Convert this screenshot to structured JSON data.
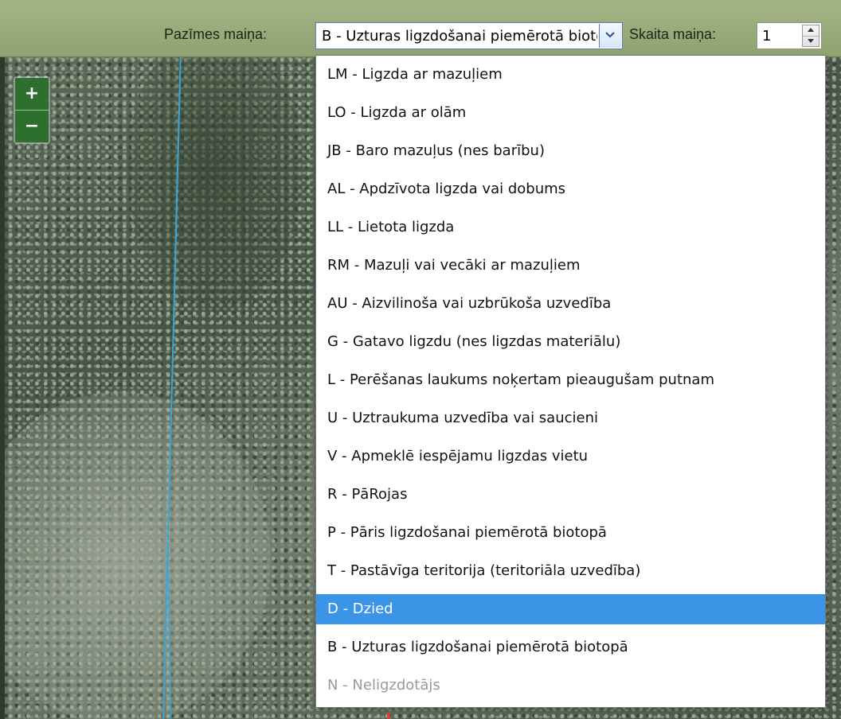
{
  "toolbar": {
    "attribute_label": "Pazīmes maiņa:",
    "attribute_value": "B - Uzturas ligzdošanai piemērotā biotopā",
    "count_label": "Skaita maiņa:",
    "count_value": "1"
  },
  "map": {
    "zoom_in_label": "+",
    "zoom_out_label": "−"
  },
  "dropdown": {
    "options": [
      {
        "label": "LM - Ligzda ar mazuļiem"
      },
      {
        "label": "LO - Ligzda ar olām"
      },
      {
        "label": "JB - Baro mazuļus (nes barību)"
      },
      {
        "label": "AL - Apdzīvota ligzda vai dobums"
      },
      {
        "label": "LL - Lietota ligzda"
      },
      {
        "label": "RM - Mazuļi vai vecāki ar mazuļiem"
      },
      {
        "label": "AU - Aizvilinoša vai uzbrūkoša uzvedība"
      },
      {
        "label": "G - Gatavo ligzdu (nes ligzdas materiālu)"
      },
      {
        "label": "L - Perēšanas laukums noķertam pieaugušam putnam"
      },
      {
        "label": "U - Uztraukuma uzvedība vai saucieni"
      },
      {
        "label": "V - Apmeklē iespējamu ligzdas vietu"
      },
      {
        "label": "R - PāRojas"
      },
      {
        "label": "P - Pāris ligzdošanai piemērotā biotopā"
      },
      {
        "label": "T - Pastāvīga teritorija (teritoriāla uzvedība)"
      },
      {
        "label": "D - Dzied"
      },
      {
        "label": "B - Uzturas ligzdošanai piemērotā biotopā"
      },
      {
        "label": "N - Neligzdotājs"
      }
    ],
    "highlighted": "D - Dzied",
    "disabled": "N - Neligzdotājs"
  },
  "colors": {
    "toolbar": "#98aa7a",
    "highlight": "#3b95e6",
    "map_line": "#39a6d8",
    "zoom_button": "#2d6f2c"
  },
  "icons": [
    "chevron-down-icon",
    "spinner-up-icon",
    "spinner-down-icon"
  ]
}
